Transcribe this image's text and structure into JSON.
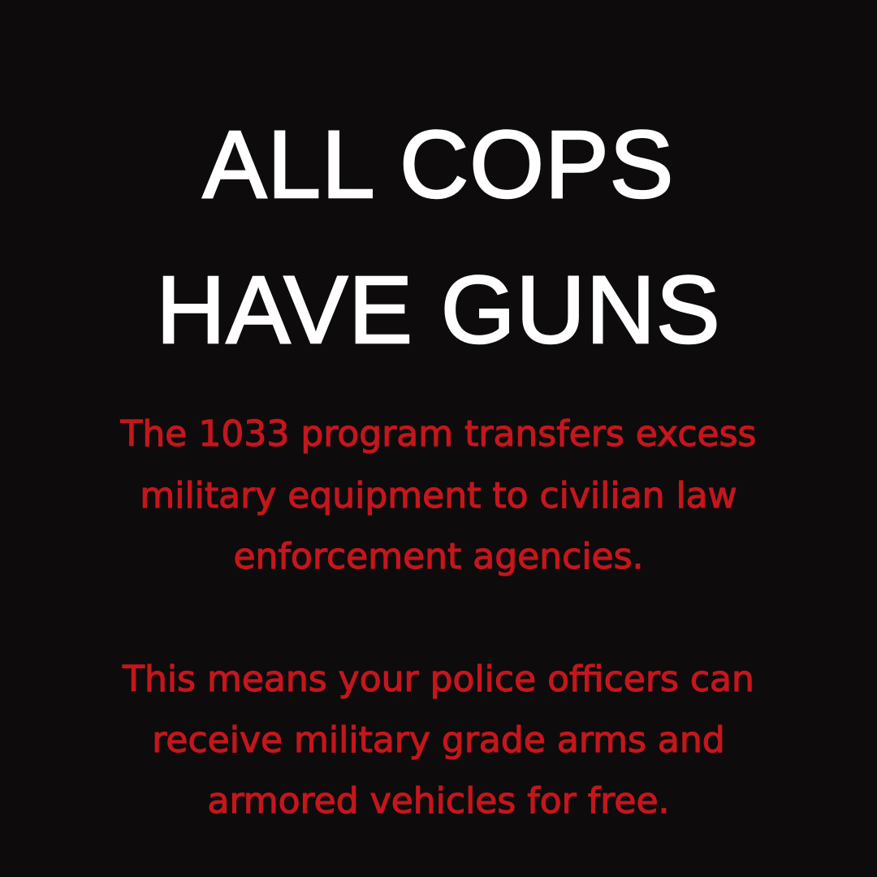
{
  "colors": {
    "background": "#0d0b0c",
    "headline": "#ffffff",
    "body": "#c4161c"
  },
  "headline": {
    "line1": "ALL COPS",
    "line2": "HAVE GUNS"
  },
  "paragraph1": {
    "line1": "The 1033 program transfers excess",
    "line2": "military equipment to civilian law",
    "line3": "enforcement agencies."
  },
  "paragraph2": {
    "line1": "This means your police officers can",
    "line2": "receive military grade arms and",
    "line3": "armored vehicles for free."
  }
}
